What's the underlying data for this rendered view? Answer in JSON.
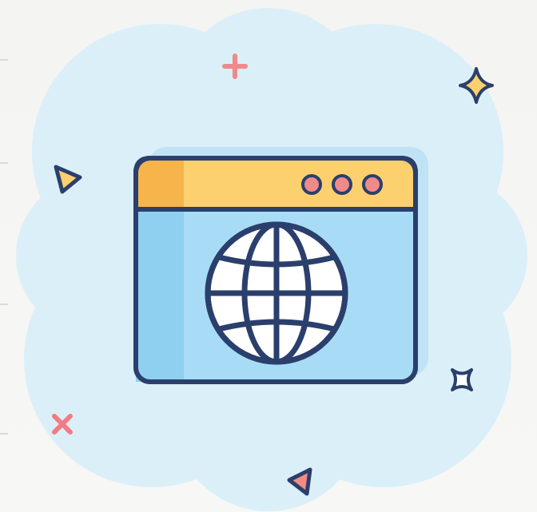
{
  "illustration": {
    "subject": "browser-window-globe",
    "icons": [
      "cloud-background",
      "browser-window-icon",
      "globe-icon",
      "window-dots-icon",
      "plus-icon",
      "sparkle-star-icon",
      "triangle-icon",
      "cross-icon",
      "four-point-star-icon"
    ]
  },
  "colors": {
    "cloud": "#dbeff8",
    "window_header": "#fcd06e",
    "window_header_shade": "#f6b44b",
    "window_body": "#a8dcf6",
    "window_body_shade": "#8fcff0",
    "outline": "#2b3f6c",
    "dots": "#ef8a8a",
    "plus": "#f08a88",
    "cross": "#f17c84",
    "star": "#2b3f6c",
    "triangle_yellow": "#fcd06e",
    "triangle_pink": "#f28b86"
  }
}
